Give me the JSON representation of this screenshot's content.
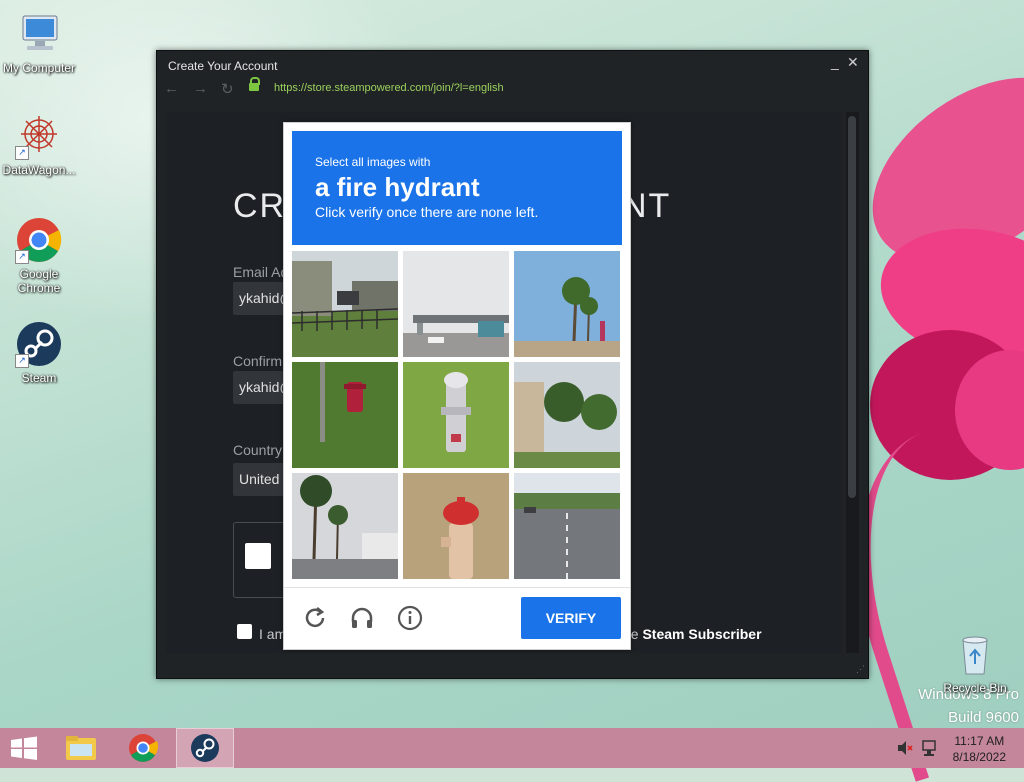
{
  "desktop": {
    "icons": [
      {
        "label": "My Computer",
        "icon": "computer-icon"
      },
      {
        "label": "DataWagon...",
        "icon": "datawagon-icon"
      },
      {
        "label": "Google Chrome",
        "icon": "chrome-icon"
      },
      {
        "label": "Steam",
        "icon": "steam-icon"
      },
      {
        "label": "Recycle Bin",
        "icon": "recycle-bin-icon"
      }
    ],
    "watermark_line1": "Windows 8 Pro",
    "watermark_line2": "Build 9600"
  },
  "window": {
    "title": "Create Your Account",
    "minimize": "_",
    "close": "✕",
    "url": "https://store.steampowered.com/join/?l=english",
    "page": {
      "heading_left": "CRE",
      "heading_right": "NT",
      "email_label": "Email Ad",
      "email_value": "ykahid@",
      "confirm_label": "Confirm",
      "confirm_value": "ykahid@",
      "country_label": "Country",
      "country_value": "United",
      "agree_left": "I am",
      "agree_right_prefix": "he ",
      "agree_right_bold": "Steam Subscriber"
    }
  },
  "captcha": {
    "line1": "Select all images with",
    "line2": "a fire hydrant",
    "line3": "Click verify once there are none left.",
    "verify_label": "VERIFY",
    "tiles": [
      {
        "name": "tile-fence-trees"
      },
      {
        "name": "tile-overpass"
      },
      {
        "name": "tile-palm-trees"
      },
      {
        "name": "tile-red-hydrant"
      },
      {
        "name": "tile-silver-hydrant"
      },
      {
        "name": "tile-house-palms"
      },
      {
        "name": "tile-street-palms"
      },
      {
        "name": "tile-red-cap-hydrant"
      },
      {
        "name": "tile-road"
      }
    ],
    "colors": {
      "accent": "#1a73e8"
    }
  },
  "taskbar": {
    "time": "11:17 AM",
    "date": "8/18/2022"
  }
}
